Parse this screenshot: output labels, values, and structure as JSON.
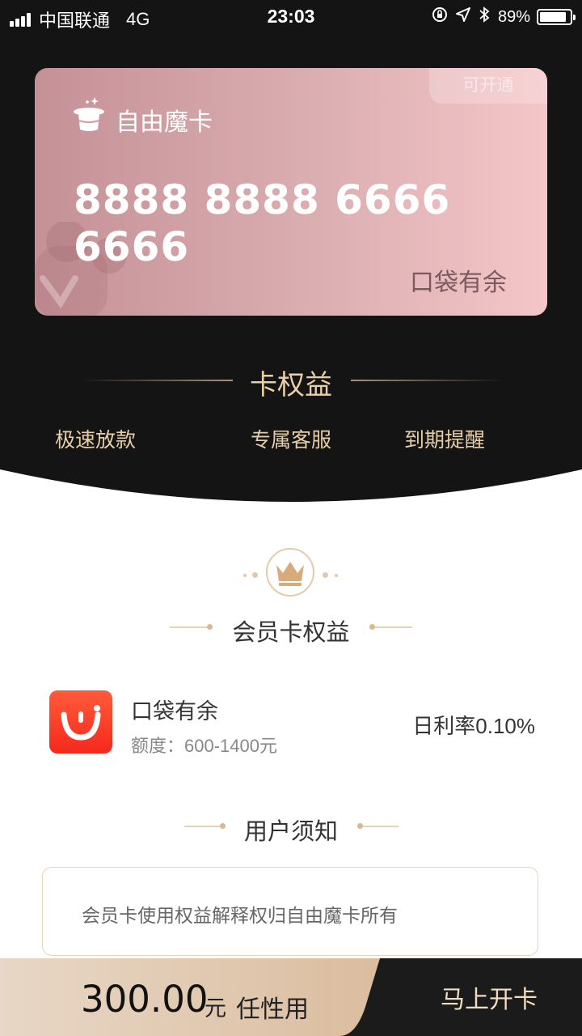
{
  "status_bar": {
    "carrier": "中国联通",
    "network": "4G",
    "time": "23:03",
    "battery": "89%",
    "battery_level": 0.89
  },
  "card": {
    "badge": "可开通",
    "title": "自由魔卡",
    "number": "8888 8888 6666 6666",
    "brand": "口袋有余"
  },
  "benefits": {
    "title": "卡权益",
    "items": [
      "极速放款",
      "专属客服",
      "到期提醒"
    ]
  },
  "member_benefits": {
    "title": "会员卡权益",
    "product": {
      "name": "口袋有余",
      "limit": "额度：600-1400元",
      "rate": "日利率0.10%"
    }
  },
  "notice": {
    "title": "用户须知",
    "text": "会员卡使用权益解释权归自由魔卡所有"
  },
  "bottom_bar": {
    "amount": "300.00",
    "unit": "元",
    "slogan": "任性用",
    "cta": "马上开卡"
  },
  "colors": {
    "dark_bg": "#141414",
    "gold": "#e7cea6",
    "card_start": "#c49196",
    "card_end": "#f4c6c8",
    "product_red": "#f5281c"
  }
}
